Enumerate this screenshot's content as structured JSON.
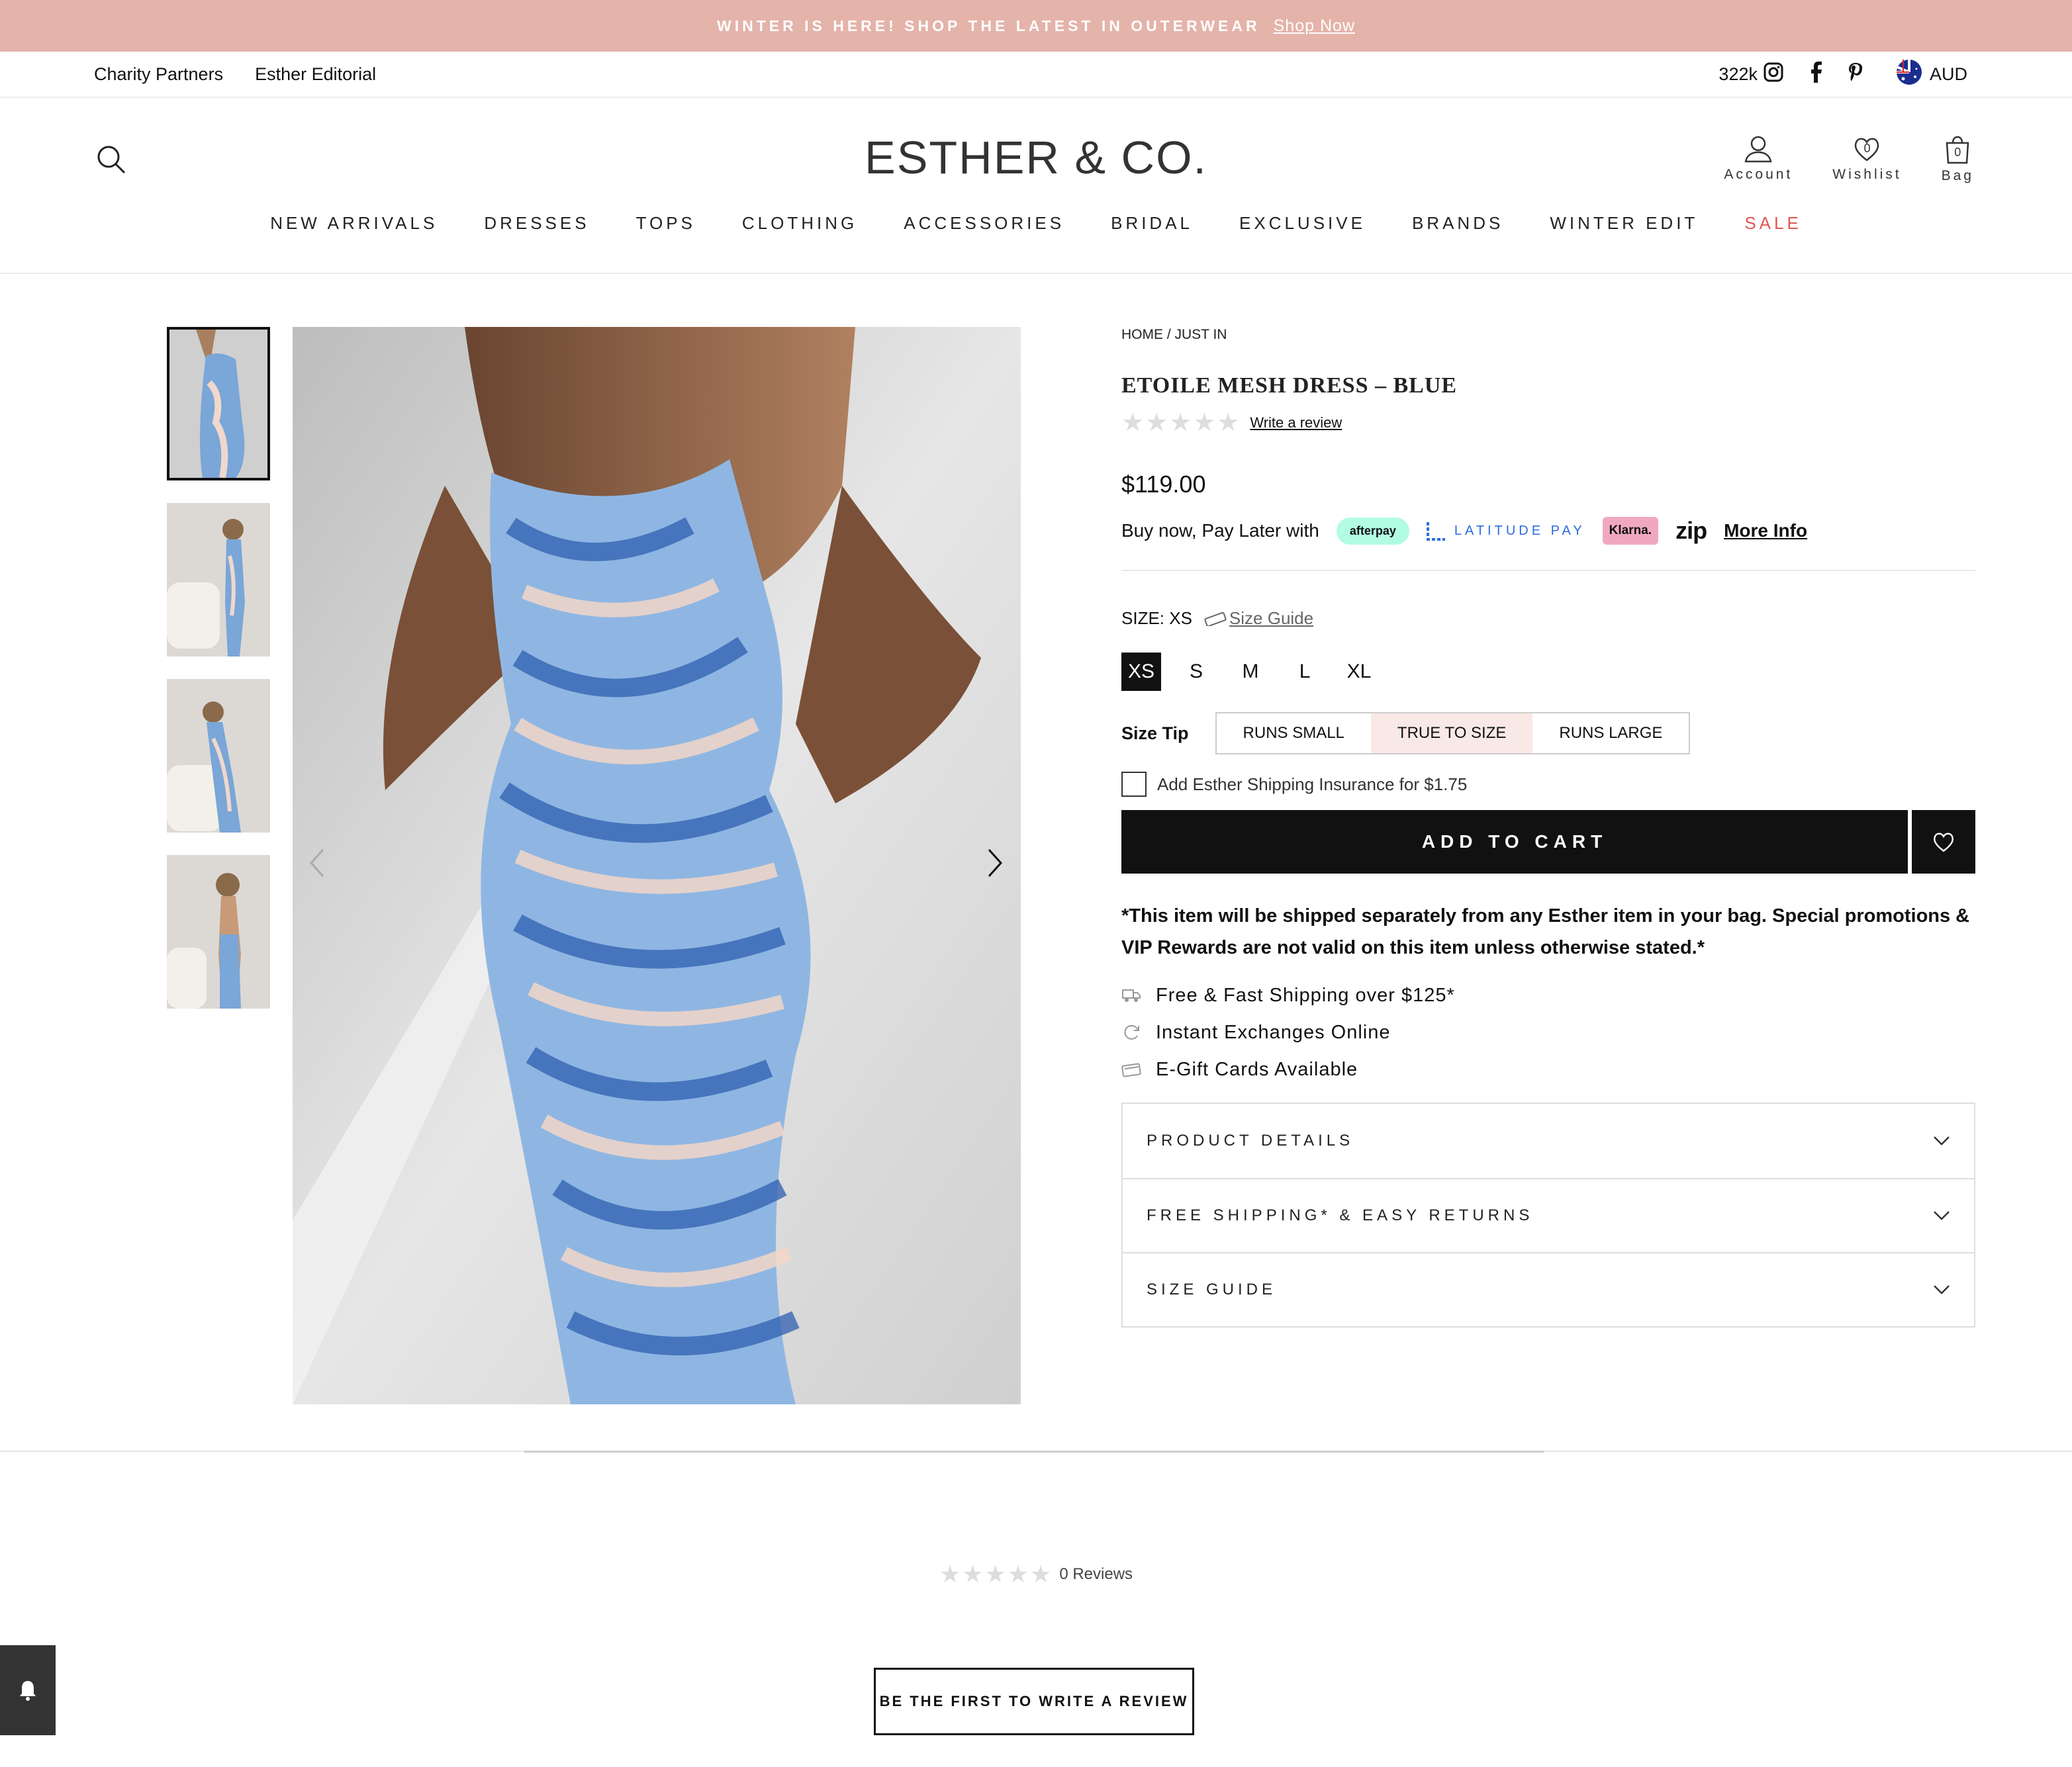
{
  "announcement": {
    "text": "WINTER IS HERE! SHOP THE LATEST IN OUTERWEAR",
    "link": "Shop Now"
  },
  "topbar": {
    "links": [
      "Charity Partners",
      "Esther Editorial"
    ],
    "followers": "322k",
    "currency": "AUD"
  },
  "header": {
    "logo": "ESTHER & CO.",
    "icons": {
      "account": "Account",
      "wishlist": "Wishlist",
      "wishlist_count": "0",
      "bag": "Bag",
      "bag_count": "0"
    },
    "nav": [
      "NEW ARRIVALS",
      "DRESSES",
      "TOPS",
      "CLOTHING",
      "ACCESSORIES",
      "BRIDAL",
      "EXCLUSIVE",
      "BRANDS",
      "WINTER EDIT",
      "SALE"
    ]
  },
  "product": {
    "breadcrumb": "HOME / JUST IN",
    "title": "ETOILE MESH DRESS – BLUE",
    "review_link": "Write a review",
    "price": "$119.00",
    "bnpl_text": "Buy now, Pay Later with",
    "afterpay": "afterpay",
    "latitude": "LATITUDE PAY",
    "klarna": "Klarna.",
    "zip": "zip",
    "more_info": "More Info",
    "size_label": "SIZE: XS",
    "size_guide_link": "Size Guide",
    "sizes": [
      "XS",
      "S",
      "M",
      "L",
      "XL"
    ],
    "size_tip_label": "Size Tip",
    "size_tips": [
      "RUNS SMALL",
      "TRUE TO SIZE",
      "RUNS LARGE"
    ],
    "insurance": "Add Esther Shipping Insurance for $1.75",
    "add_to_cart": "ADD TO CART",
    "note": "*This item will be shipped separately from any Esther item in your bag. Special promotions & VIP Rewards are not valid on this item unless otherwise stated.*",
    "perks": [
      "Free & Fast Shipping over $125*",
      "Instant Exchanges Online",
      "E-Gift Cards Available"
    ],
    "accordion": [
      "PRODUCT DETAILS",
      "FREE SHIPPING* & EASY RETURNS",
      "SIZE GUIDE"
    ]
  },
  "reviews": {
    "count": "0 Reviews",
    "cta": "BE THE FIRST TO WRITE A REVIEW"
  },
  "colors": {
    "announce": "#e4b3a9",
    "sale": "#e0574f",
    "afterpay": "#b2fce4",
    "klarna": "#f0a8c0",
    "latitude": "#2c6ce0"
  }
}
